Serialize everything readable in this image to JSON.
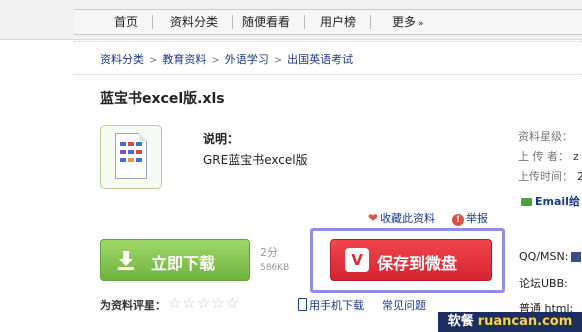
{
  "nav": {
    "items": [
      "首页",
      "资料分类",
      "随便看看",
      "用户榜",
      "更多"
    ],
    "more_arrow": "»"
  },
  "breadcrumb": [
    "资料分类",
    "教育资料",
    "外语学习",
    "出国英语考试"
  ],
  "breadcrumb_sep": ">",
  "file": {
    "title": "蓝宝书excel版.xls",
    "icon": "excel-file-icon",
    "description_label": "说明：",
    "description": "GRE蓝宝书excel版"
  },
  "sidebar": {
    "rating_label": "资料星级：",
    "uploader_label": "上 传 者：",
    "uploader_val": "z",
    "upload_time_label": "上传时间：",
    "upload_time_val": "2",
    "email_label": "Email给",
    "qq_label": "QQ/MSN:",
    "forum_label": "论坛UBB:",
    "normal_label": "普通 html:"
  },
  "actions": {
    "favorite": "收藏此资料",
    "report": "举报"
  },
  "download": {
    "label": "立即下载",
    "points": "2分",
    "size": "586KB"
  },
  "save": {
    "label": "保存到微盘",
    "icon_letter": "V"
  },
  "rating": {
    "label": "为资料评星：",
    "stars": "☆☆☆☆☆",
    "value": 0,
    "max": 5
  },
  "mobile_download": "用手机下载",
  "faq": "常见问题",
  "watermark": {
    "cn": "软餐",
    "en": "ruancan.com"
  },
  "colors": {
    "download_green": "#6fb23f",
    "save_red": "#e02b36",
    "link_blue": "#1a3a8a",
    "highlight_frame": "#8e8fe8"
  }
}
